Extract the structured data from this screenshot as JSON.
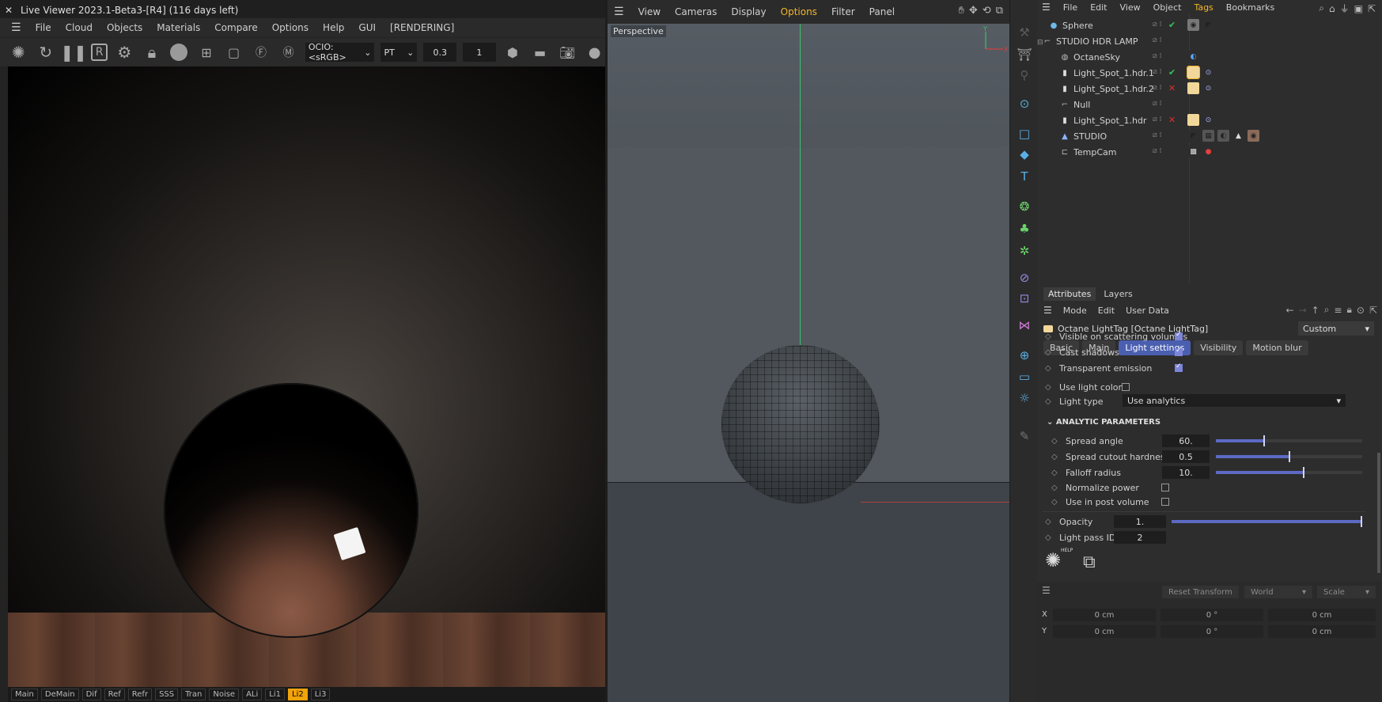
{
  "live_viewer": {
    "close": "✕",
    "title": "Live Viewer 2023.1-Beta3-[R4] (116 days left)",
    "menu": [
      "File",
      "Cloud",
      "Objects",
      "Materials",
      "Compare",
      "Options",
      "Help",
      "GUI",
      "[RENDERING]"
    ],
    "ocio": "OCIO:<sRGB>",
    "kernel": "PT",
    "value_a": "0.3",
    "value_b": "1",
    "passes": [
      "Main",
      "DeMain",
      "Dif",
      "Ref",
      "Refr",
      "SSS",
      "Tran",
      "Noise",
      "ALi",
      "Li1",
      "Li2",
      "Li3"
    ],
    "active_pass": "Li2",
    "pass_active_color": "#f0a30a"
  },
  "viewport": {
    "menu": [
      "View",
      "Cameras",
      "Display",
      "Options",
      "Filter",
      "Panel"
    ],
    "highlight": "Options",
    "camera_label": "Perspective",
    "axis_y": "Y",
    "axis_x": "X"
  },
  "object_manager": {
    "menu": [
      "File",
      "Edit",
      "View",
      "Object",
      "Tags",
      "Bookmarks"
    ],
    "highlight": "Tags",
    "objects": [
      {
        "name": "Sphere",
        "status": "check"
      },
      {
        "name": "STUDIO HDR LAMP",
        "status": ""
      },
      {
        "name": "OctaneSky",
        "status": ""
      },
      {
        "name": "Light_Spot_1.hdr.1",
        "status": "check"
      },
      {
        "name": "Light_Spot_1.hdr.2",
        "status": "cross"
      },
      {
        "name": "Null",
        "status": ""
      },
      {
        "name": "Light_Spot_1.hdr",
        "status": "cross"
      },
      {
        "name": "STUDIO",
        "status": ""
      },
      {
        "name": "TempCam",
        "status": ""
      }
    ]
  },
  "attributes": {
    "tabs": [
      "Attributes",
      "Layers"
    ],
    "menu": [
      "Mode",
      "Edit",
      "User Data"
    ],
    "object_title": "Octane LightTag [Octane LightTag]",
    "preset": "Custom",
    "light_tabs": [
      "Basic",
      "Main",
      "Light settings",
      "Visibility",
      "Motion blur"
    ],
    "active_tab": "Light settings",
    "visible_on_scattering": "Visible on scattering volumes",
    "cast_shadows": "Cast shadows",
    "transparent_emission": "Transparent emission",
    "use_light_color": "Use light color",
    "light_type_label": "Light type",
    "light_type_value": "Use analytics",
    "section": "ANALYTIC PARAMETERS",
    "spread_angle_label": "Spread angle",
    "spread_angle": "60.",
    "spread_angle_frac": 0.33,
    "spread_cutout_label": "Spread cutout hardness",
    "spread_cutout": "0.5",
    "spread_cutout_frac": 0.5,
    "falloff_label": "Falloff radius",
    "falloff": "10.",
    "falloff_frac": 0.6,
    "normalize_power": "Normalize power",
    "use_post_volume": "Use in post volume",
    "opacity_label": "Opacity",
    "opacity": "1.",
    "opacity_frac": 1.0,
    "pass_id_label": "Light pass ID",
    "pass_id": "2",
    "help": "HELP"
  },
  "coordinates": {
    "reset": "Reset Transform",
    "space": "World",
    "mode": "Scale",
    "rows": [
      {
        "axis": "X",
        "pos": "0 cm",
        "rot": "0 °",
        "scale": "0 cm"
      },
      {
        "axis": "Y",
        "pos": "0 cm",
        "rot": "0 °",
        "scale": "0 cm"
      }
    ]
  },
  "colors": {
    "accent": "#f2b62b",
    "check": "#39c05a",
    "cross": "#d8322e",
    "slider": "#5c6ac4",
    "tab_active": "#4b5fb0"
  }
}
